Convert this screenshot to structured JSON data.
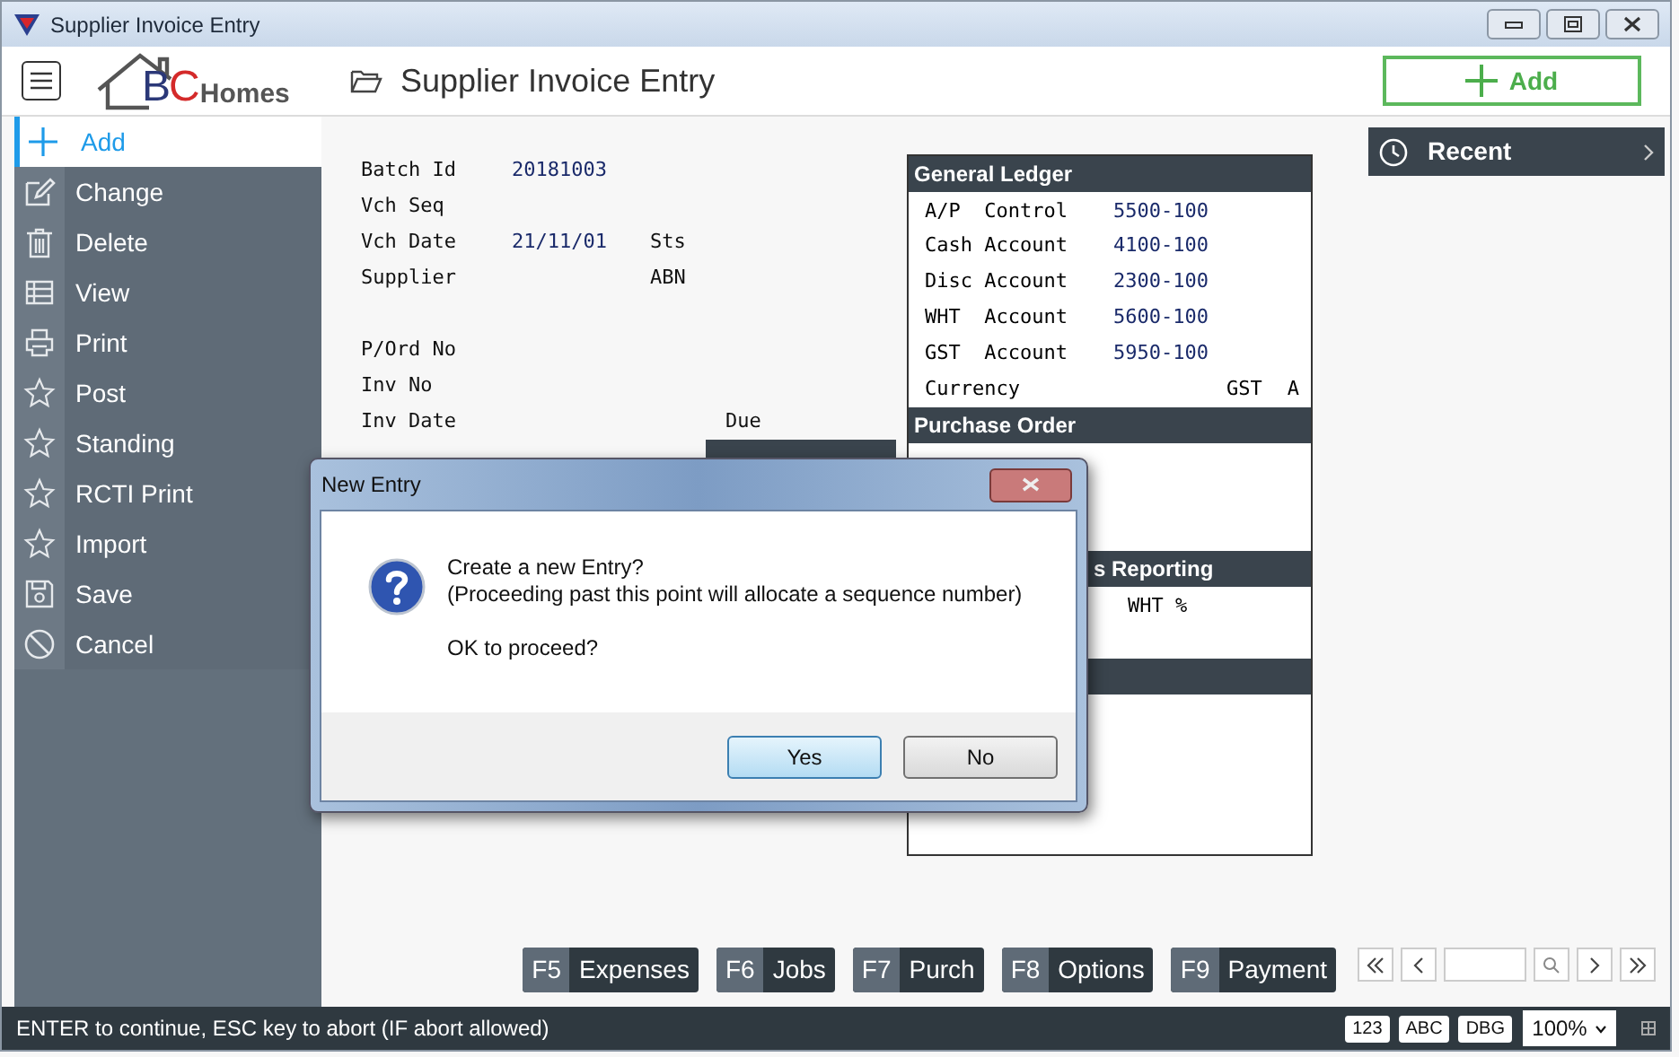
{
  "window": {
    "title": "Supplier Invoice Entry"
  },
  "header": {
    "logo": "BC",
    "logo_suffix": "Homes",
    "title": "Supplier Invoice Entry",
    "add_button": "Add"
  },
  "sidebar": {
    "items": [
      {
        "label": "Add",
        "selected": true
      },
      {
        "label": "Change",
        "selected": false
      },
      {
        "label": "Delete",
        "selected": false
      },
      {
        "label": "View",
        "selected": false
      },
      {
        "label": "Print",
        "selected": false
      },
      {
        "label": "Post",
        "selected": false
      },
      {
        "label": "Standing",
        "selected": false
      },
      {
        "label": "RCTI Print",
        "selected": false
      },
      {
        "label": "Import",
        "selected": false
      },
      {
        "label": "Save",
        "selected": false
      },
      {
        "label": "Cancel",
        "selected": false
      }
    ]
  },
  "form": {
    "rows": [
      {
        "label": "Batch Id",
        "value": "20181003"
      },
      {
        "label": "Vch Seq"
      },
      {
        "label": "Vch Date",
        "value": "21/11/01",
        "side_label": "Sts"
      },
      {
        "label": "Supplier",
        "side_label": "ABN"
      },
      {
        "label": "P/Ord No"
      },
      {
        "label": "Inv No"
      },
      {
        "label": "Inv Date",
        "due_label": "Due"
      },
      {
        "panel_bar": true
      }
    ]
  },
  "ledger": {
    "sections": [
      {
        "title": "General Ledger",
        "rows": [
          {
            "label": "A/P  Control",
            "value": "5500-100"
          },
          {
            "label": "Cash Account",
            "value": "4100-100"
          },
          {
            "label": "Disc Account",
            "value": "2300-100"
          },
          {
            "label": "WHT  Account",
            "value": "5600-100"
          },
          {
            "label": "GST  Account",
            "value": "5950-100"
          },
          {
            "label": "Currency",
            "tail": [
              "GST",
              "A"
            ]
          }
        ]
      },
      {
        "title": "Purchase Order"
      },
      {
        "title": "s Reporting",
        "rows": [
          {
            "label": "WHT %"
          }
        ]
      }
    ]
  },
  "recent": {
    "label": "Recent"
  },
  "function_keys": [
    {
      "key": "F5",
      "label": "Expenses"
    },
    {
      "key": "F6",
      "label": "Jobs"
    },
    {
      "key": "F7",
      "label": "Purch"
    },
    {
      "key": "F8",
      "label": "Options"
    },
    {
      "key": "F9",
      "label": "Payment"
    }
  ],
  "status_bar": {
    "message": "ENTER to continue, ESC key to abort (IF abort allowed)",
    "badges": [
      "123",
      "ABC",
      "DBG"
    ],
    "zoom": "100%"
  },
  "dialog": {
    "title": "New Entry",
    "lines": [
      "Create a new Entry?",
      "(Proceeding past this point will allocate a sequence number)"
    ],
    "question": "OK to proceed?",
    "buttons": [
      {
        "label": "Yes",
        "default": true
      },
      {
        "label": "No",
        "default": false
      }
    ]
  }
}
